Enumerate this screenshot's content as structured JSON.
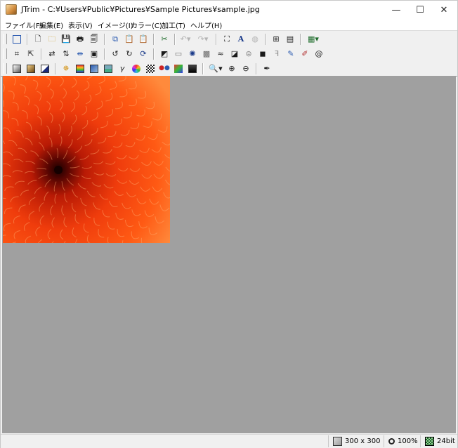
{
  "window": {
    "title": "JTrim - C:¥Users¥Public¥Pictures¥Sample Pictures¥sample.jpg",
    "minimize": "—",
    "maximize": "☐",
    "close": "✕"
  },
  "menu": [
    {
      "label": "ファイル(F)"
    },
    {
      "label": "編集(E)"
    },
    {
      "label": "表示(V)"
    },
    {
      "label": "イメージ(I)"
    },
    {
      "label": "カラー(C)"
    },
    {
      "label": "加工(T)"
    },
    {
      "label": "ヘルプ(H)"
    }
  ],
  "toolbar": {
    "row1": [
      "new-window-icon",
      "new-file-icon",
      "open-folder-icon",
      "save-icon",
      "print-icon",
      "print-preview-icon",
      "copy-icon",
      "paste-icon",
      "paste-new-icon",
      "capture-icon",
      "undo-icon",
      "redo-icon",
      "fit-window-icon",
      "text-icon",
      "globe-icon",
      "thumbnail-icon",
      "filmstrip-icon",
      "batch-icon"
    ],
    "row2": [
      "crop-icon",
      "resize-icon",
      "flip-horizontal-icon",
      "flip-vertical-icon",
      "mirror-icon",
      "frame-icon",
      "rotate-left-icon",
      "rotate-right-icon",
      "rotate-free-icon",
      "emboss-icon",
      "shadow-icon",
      "light-burst-icon",
      "mosaic-icon",
      "wave-icon",
      "blur-icon",
      "lens-icon",
      "pixelate-icon",
      "sharpen-icon",
      "pen-icon",
      "brush-icon",
      "spiral-icon"
    ],
    "row3": [
      "grayscale-icon",
      "sepia-icon",
      "negative-icon",
      "brightness-icon",
      "color-balance-icon",
      "hue-icon",
      "image-adjust-icon",
      "gamma-icon",
      "color-wheel-icon",
      "checker-icon",
      "rgb-icon",
      "hdr-icon",
      "contrast-icon",
      "zoom-icon",
      "zoom-in-icon",
      "zoom-out-icon",
      "eyedropper-icon"
    ]
  },
  "image": {
    "alt": "sample.jpg",
    "colors": {
      "center": "#1a0000",
      "mid": "#b81a05",
      "petal": "#ff5a14",
      "edge": "#ff8a3c"
    }
  },
  "status": {
    "size": "300 x 300",
    "zoom": "100%",
    "depth": "24bit"
  },
  "colors": {
    "canvas_bg": "#a0a0a0",
    "toolbar_bg": "#f0f0f0"
  }
}
